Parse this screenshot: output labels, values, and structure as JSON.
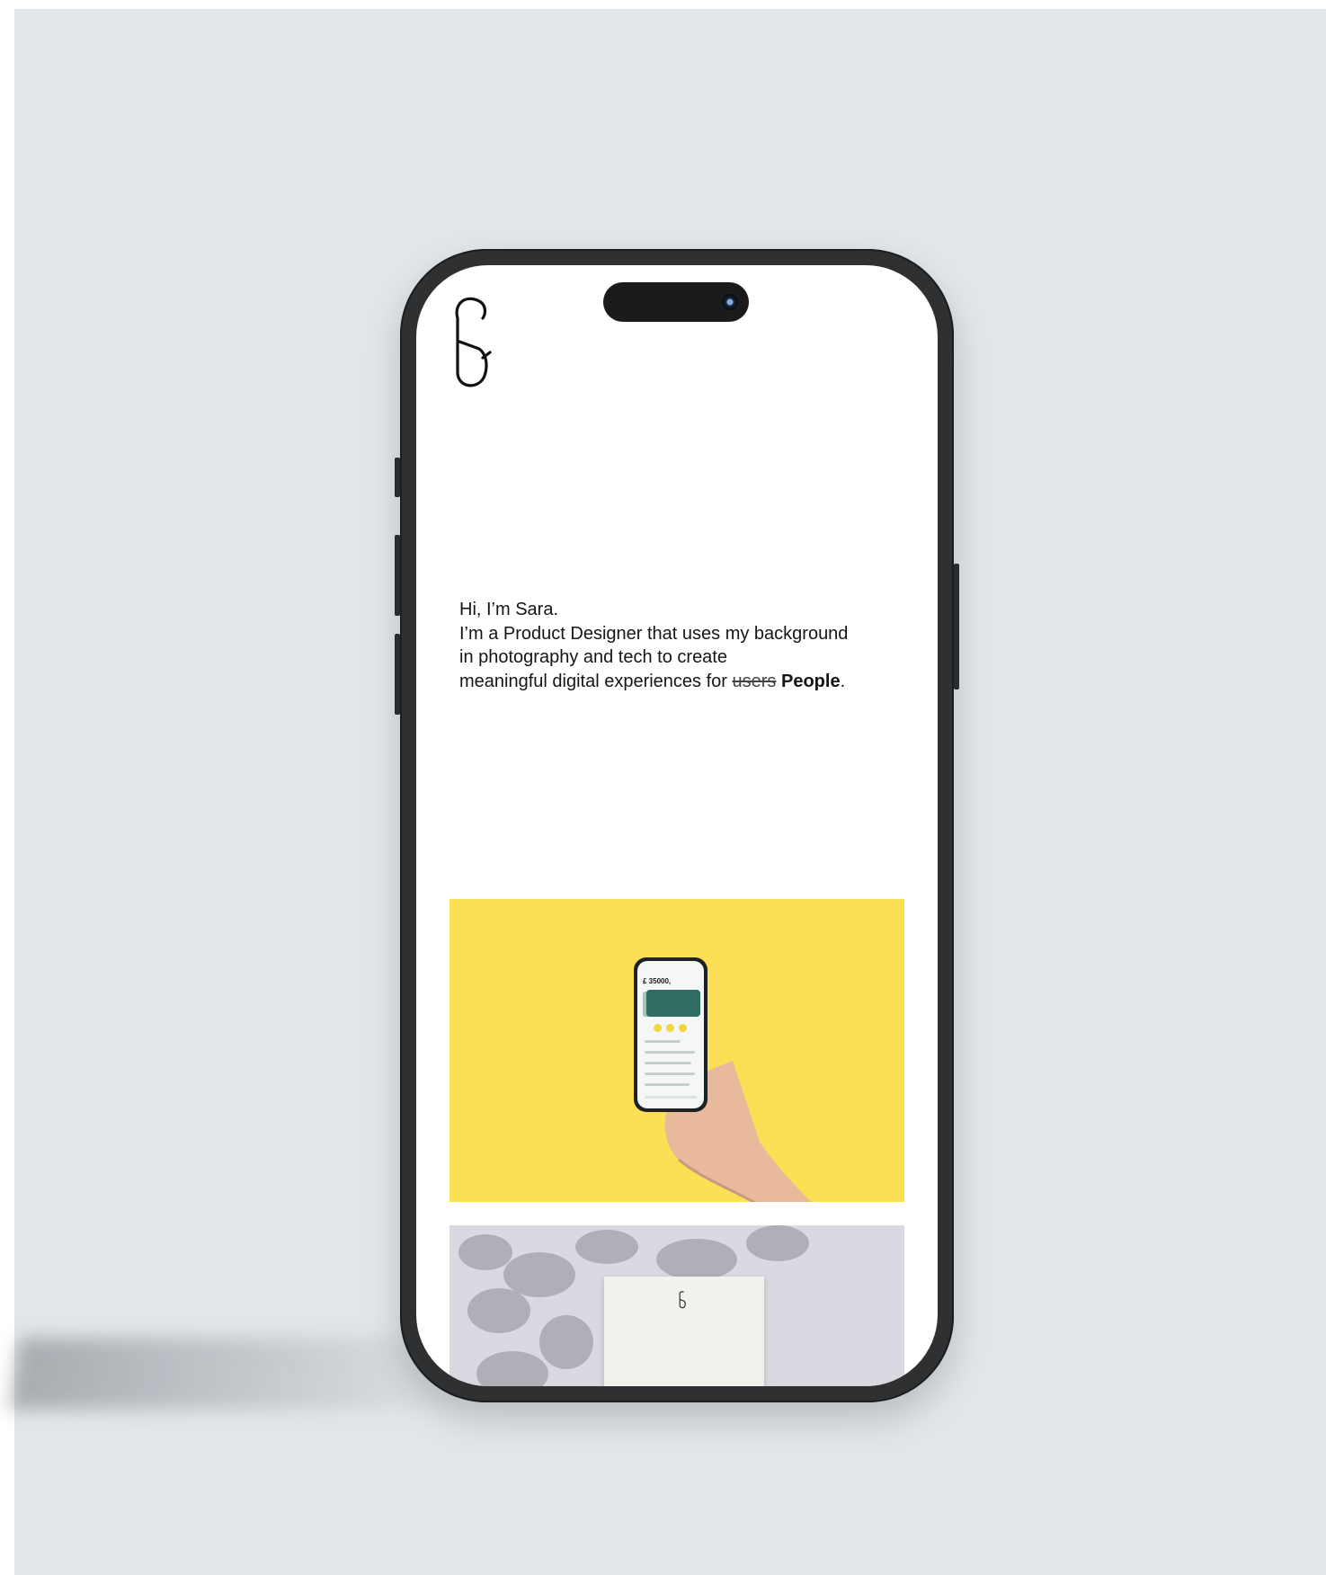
{
  "intro": {
    "greeting": "Hi, I’m Sara.",
    "line1": "I’m a Product Designer that uses my background",
    "line2": "in photography and tech to create",
    "line3_prefix": "meaningful digital experiences for ",
    "struck_word": "users",
    "bold_word": "People",
    "line3_suffix": "."
  },
  "mockup": {
    "balance": "£ 35000,"
  },
  "icons": [
    "sg-monogram-icon",
    "camera-icon"
  ],
  "colors": {
    "background": "#e1e6ea",
    "phone_frame": "#2f3032",
    "yellow_card": "#fbe055",
    "gray_card": "#d9d9e1"
  }
}
